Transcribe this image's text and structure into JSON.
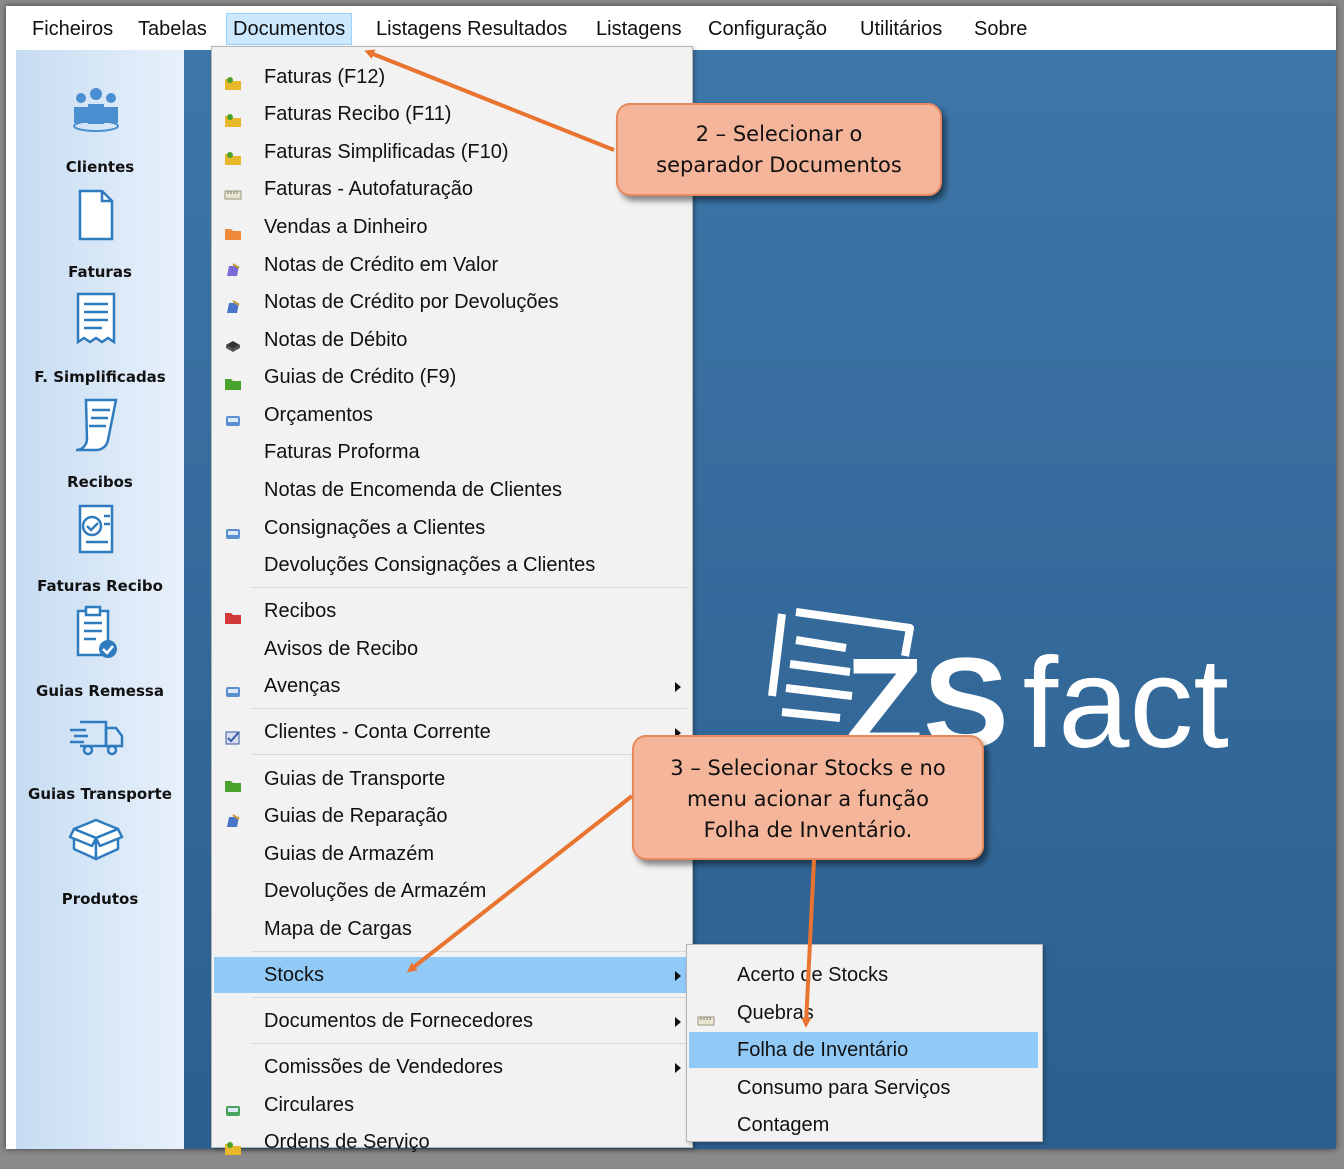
{
  "menubar": {
    "items": [
      "Ficheiros",
      "Tabelas",
      "Documentos",
      "Listagens Resultados",
      "Listagens",
      "Configuração",
      "Utilitários",
      "Sobre"
    ],
    "active": "Documentos"
  },
  "sidebar": {
    "items": [
      {
        "label": "Clientes",
        "icon": "clients-icon"
      },
      {
        "label": "Faturas",
        "icon": "document-icon"
      },
      {
        "label": "F. Simplificadas",
        "icon": "receipt-icon"
      },
      {
        "label": "Recibos",
        "icon": "receipt-curl-icon"
      },
      {
        "label": "Faturas Recibo",
        "icon": "invoice-check-icon"
      },
      {
        "label": "Guias Remessa",
        "icon": "clipboard-check-icon"
      },
      {
        "label": "Guias Transporte",
        "icon": "truck-icon"
      },
      {
        "label": "Produtos",
        "icon": "box-icon"
      }
    ]
  },
  "menu": {
    "items": [
      {
        "label": "Faturas (F12)",
        "icon": "star-folder-icon",
        "color": "#e7b92a"
      },
      {
        "label": "Faturas Recibo (F11)",
        "icon": "star-folder-icon",
        "color": "#e7b92a"
      },
      {
        "label": "Faturas Simplificadas (F10)",
        "icon": "star-folder-icon",
        "color": "#e7b92a"
      },
      {
        "label": "Faturas - Autofaturação",
        "icon": "ruler-icon",
        "color": "#e9e4cf"
      },
      {
        "label": "Vendas a Dinheiro",
        "icon": "orange-folder-icon",
        "color": "#f08a3a"
      },
      {
        "label": "Notas de Crédito em Valor",
        "icon": "pencil-doc-icon",
        "color": "#7a6ad8"
      },
      {
        "label": "Notas de Crédito por Devoluções",
        "icon": "blue-doc-icon",
        "color": "#4a74c9"
      },
      {
        "label": "Notas de Débito",
        "icon": "black-disk-icon",
        "color": "#333333"
      },
      {
        "label": "Guias de Crédito (F9)",
        "icon": "green-folder-icon",
        "color": "#4aa32c"
      },
      {
        "label": "Orçamentos",
        "icon": "blue-card-icon",
        "color": "#5c8fd0"
      },
      {
        "label": "Faturas Proforma",
        "icon": "",
        "color": ""
      },
      {
        "label": "Notas de Encomenda de Clientes",
        "icon": "",
        "color": ""
      },
      {
        "label": "Consignações a Clientes",
        "icon": "blue-card-icon",
        "color": "#5c8fd0"
      },
      {
        "label": "Devoluções Consignações a Clientes",
        "icon": "",
        "color": ""
      },
      {
        "label": "Recibos",
        "icon": "red-folder-icon",
        "color": "#d23a3a"
      },
      {
        "label": "Avisos de Recibo",
        "icon": "",
        "color": ""
      },
      {
        "label": "Avenças",
        "icon": "blue-card-icon",
        "color": "#5c8fd0",
        "submenu": true
      },
      {
        "label": "Clientes - Conta Corrente",
        "icon": "blue-check-icon",
        "color": "#3a5aa8",
        "submenu": true
      },
      {
        "label": "Guias de Transporte",
        "icon": "green-folder-icon",
        "color": "#4aa32c"
      },
      {
        "label": "Guias de Reparação",
        "icon": "blue-doc-icon",
        "color": "#4a74c9"
      },
      {
        "label": "Guias de Armazém",
        "icon": "",
        "color": ""
      },
      {
        "label": "Devoluções de Armazém",
        "icon": "",
        "color": ""
      },
      {
        "label": "Mapa de Cargas",
        "icon": "",
        "color": ""
      },
      {
        "label": "Stocks",
        "icon": "",
        "color": "",
        "submenu": true,
        "selected": true
      },
      {
        "label": "Documentos de Fornecedores",
        "icon": "",
        "color": "",
        "submenu": true
      },
      {
        "label": "Comissões de Vendedores",
        "icon": "",
        "color": "",
        "submenu": true
      },
      {
        "label": "Circulares",
        "icon": "green-card-icon",
        "color": "#4aa35c"
      },
      {
        "label": "Ordens de Serviço",
        "icon": "star-folder-icon",
        "color": "#e7b92a"
      }
    ]
  },
  "submenu": {
    "items": [
      {
        "label": "Acerto de Stocks",
        "icon": ""
      },
      {
        "label": "Quebras",
        "icon": "ruler-icon"
      },
      {
        "label": "Folha de Inventário",
        "icon": "",
        "selected": true
      },
      {
        "label": "Consumo para Serviços",
        "icon": ""
      },
      {
        "label": "Contagem",
        "icon": ""
      }
    ]
  },
  "callouts": {
    "step2": [
      "2 – Selecionar o",
      "separador Documentos"
    ],
    "step3": [
      "3 – Selecionar Stocks e no",
      "menu acionar a função",
      "Folha de Inventário."
    ]
  },
  "logo": {
    "brand_bold": "ZS",
    "brand_light": "fact"
  },
  "colors": {
    "desktop": "#3d76a8",
    "highlight": "#91c9f7",
    "callout_fill": "#f5b59a",
    "arrow": "#e8742f"
  }
}
